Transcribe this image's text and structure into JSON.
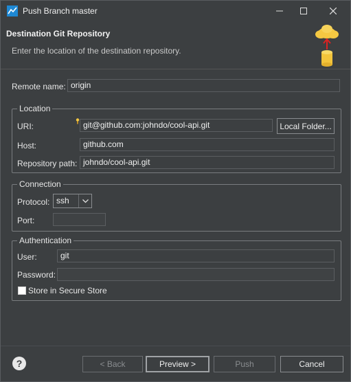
{
  "window": {
    "title": "Push Branch master",
    "icon": "eclipse-git-icon",
    "controls": {
      "minimize": "minimize-icon",
      "maximize": "maximize-icon",
      "close": "close-icon"
    }
  },
  "banner": {
    "title": "Destination Git Repository",
    "description": "Enter the location of the destination repository.",
    "graphic": "cloud-upload-to-database-icon"
  },
  "remote": {
    "label": "Remote name:",
    "value": "origin"
  },
  "location": {
    "group_title": "Location",
    "uri_label": "URI:",
    "uri_value": "git@github.com:johndo/cool-api.git",
    "local_folder_button": "Local Folder...",
    "host_label": "Host:",
    "host_value": "github.com",
    "repo_path_label": "Repository path:",
    "repo_path_value": "johndo/cool-api.git"
  },
  "connection": {
    "group_title": "Connection",
    "protocol_label": "Protocol:",
    "protocol_value": "ssh",
    "port_label": "Port:",
    "port_value": ""
  },
  "authentication": {
    "group_title": "Authentication",
    "user_label": "User:",
    "user_value": "git",
    "password_label": "Password:",
    "password_value": "",
    "store_label": "Store in Secure Store",
    "store_checked": false
  },
  "footer": {
    "help_icon": "help-icon",
    "back_label": "< Back",
    "preview_label": "Preview >",
    "push_label": "Push",
    "cancel_label": "Cancel"
  }
}
